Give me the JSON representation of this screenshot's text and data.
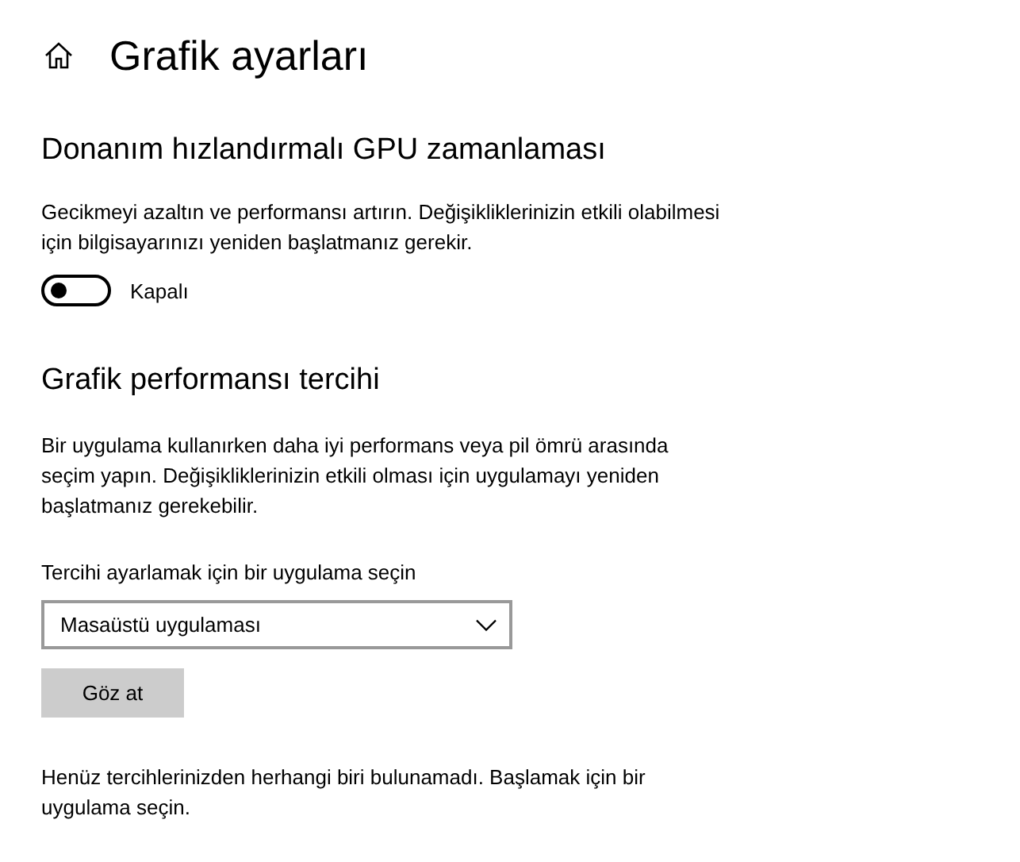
{
  "page": {
    "title": "Grafik ayarları"
  },
  "gpu_scheduling": {
    "heading": "Donanım hızlandırmalı GPU zamanlaması",
    "description": "Gecikmeyi azaltın ve performansı artırın. Değişikliklerinizin etkili olabilmesi için bilgisayarınızı yeniden başlatmanız gerekir.",
    "toggle": {
      "on": false,
      "label": "Kapalı"
    }
  },
  "graphics_preference": {
    "heading": "Grafik performansı tercihi",
    "description": "Bir uygulama kullanırken daha iyi performans veya pil ömrü arasında seçim yapın. Değişikliklerinizin etkili olması için uygulamayı yeniden başlatmanız gerekebilir.",
    "select_label": "Tercihi ayarlamak için bir uygulama seçin",
    "dropdown": {
      "value": "Masaüstü uygulaması"
    },
    "browse_button": "Göz at",
    "empty_message": "Henüz tercihlerinizden herhangi biri bulunamadı. Başlamak için bir uygulama seçin."
  }
}
